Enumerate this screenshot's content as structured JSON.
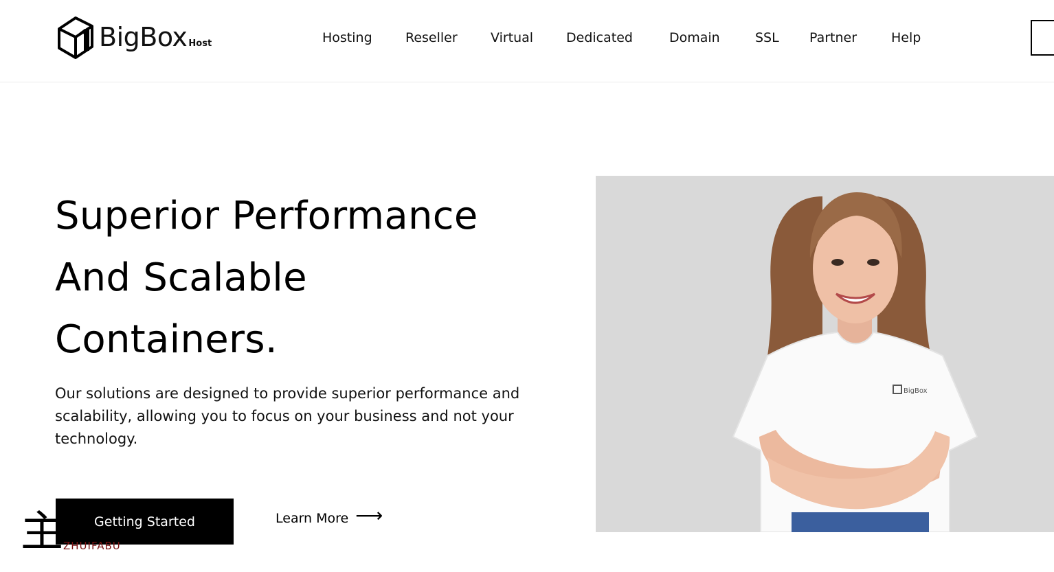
{
  "brand": {
    "name": "BigBox",
    "suffix": "Host"
  },
  "nav": {
    "items": [
      {
        "label": "Hosting"
      },
      {
        "label": "Reseller"
      },
      {
        "label": "Virtual"
      },
      {
        "label": "Dedicated"
      },
      {
        "label": "Domain"
      },
      {
        "label": "SSL"
      },
      {
        "label": "Partner"
      },
      {
        "label": "Help"
      }
    ]
  },
  "hero": {
    "title_lines": [
      "Superior Performance",
      "And Scalable",
      "Containers."
    ],
    "description": "Our solutions are designed to provide superior performance and scalability, allowing you to focus on your business and not your technology.",
    "primary_button": "Getting Started",
    "secondary_link": "Learn More",
    "image_shirt_text": "BigBox"
  },
  "watermark": {
    "glyph": "主",
    "text": "ZHUIFABU"
  },
  "colors": {
    "accent": "#000000",
    "background": "#ffffff",
    "image_bg": "#d9d9d9"
  }
}
